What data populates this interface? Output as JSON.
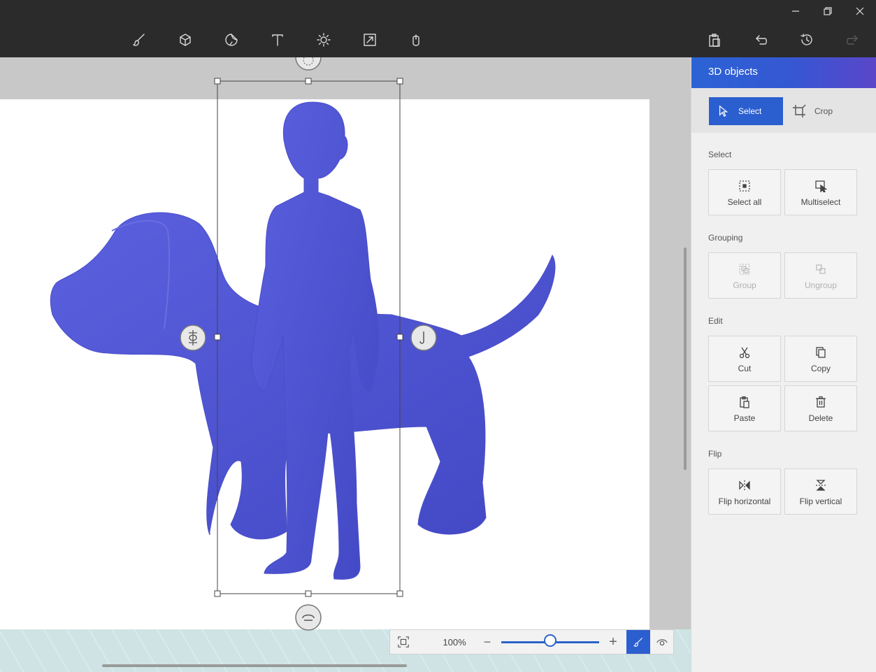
{
  "window": {
    "minimize_icon": "minimize-icon",
    "restore_icon": "restore-icon",
    "close_icon": "close-icon"
  },
  "toolbar": {
    "tools": [
      "brush-icon",
      "3d-shapes-icon",
      "stickers-icon",
      "text-icon",
      "effects-icon",
      "canvas-icon",
      "3d-library-icon"
    ],
    "right": [
      "paste-icon",
      "undo-icon",
      "history-icon",
      "redo-icon"
    ]
  },
  "zoom": {
    "value": "100%",
    "minus": "−",
    "plus": "+",
    "level_fraction": 0.5
  },
  "panel": {
    "title": "3D objects",
    "modes": {
      "select": "Select",
      "crop": "Crop",
      "active": "select"
    },
    "sections": {
      "select": {
        "label": "Select",
        "buttons": {
          "select_all": "Select all",
          "multiselect": "Multiselect"
        }
      },
      "grouping": {
        "label": "Grouping",
        "buttons": {
          "group": "Group",
          "ungroup": "Ungroup"
        }
      },
      "edit": {
        "label": "Edit",
        "buttons": {
          "cut": "Cut",
          "copy": "Copy",
          "paste": "Paste",
          "delete": "Delete"
        }
      },
      "flip": {
        "label": "Flip",
        "buttons": {
          "horizontal": "Flip horizontal",
          "vertical": "Flip vertical"
        }
      }
    }
  },
  "colors": {
    "topbar": "#2b2b2b",
    "accent": "#2b5fcf",
    "model": "#5559d6"
  }
}
